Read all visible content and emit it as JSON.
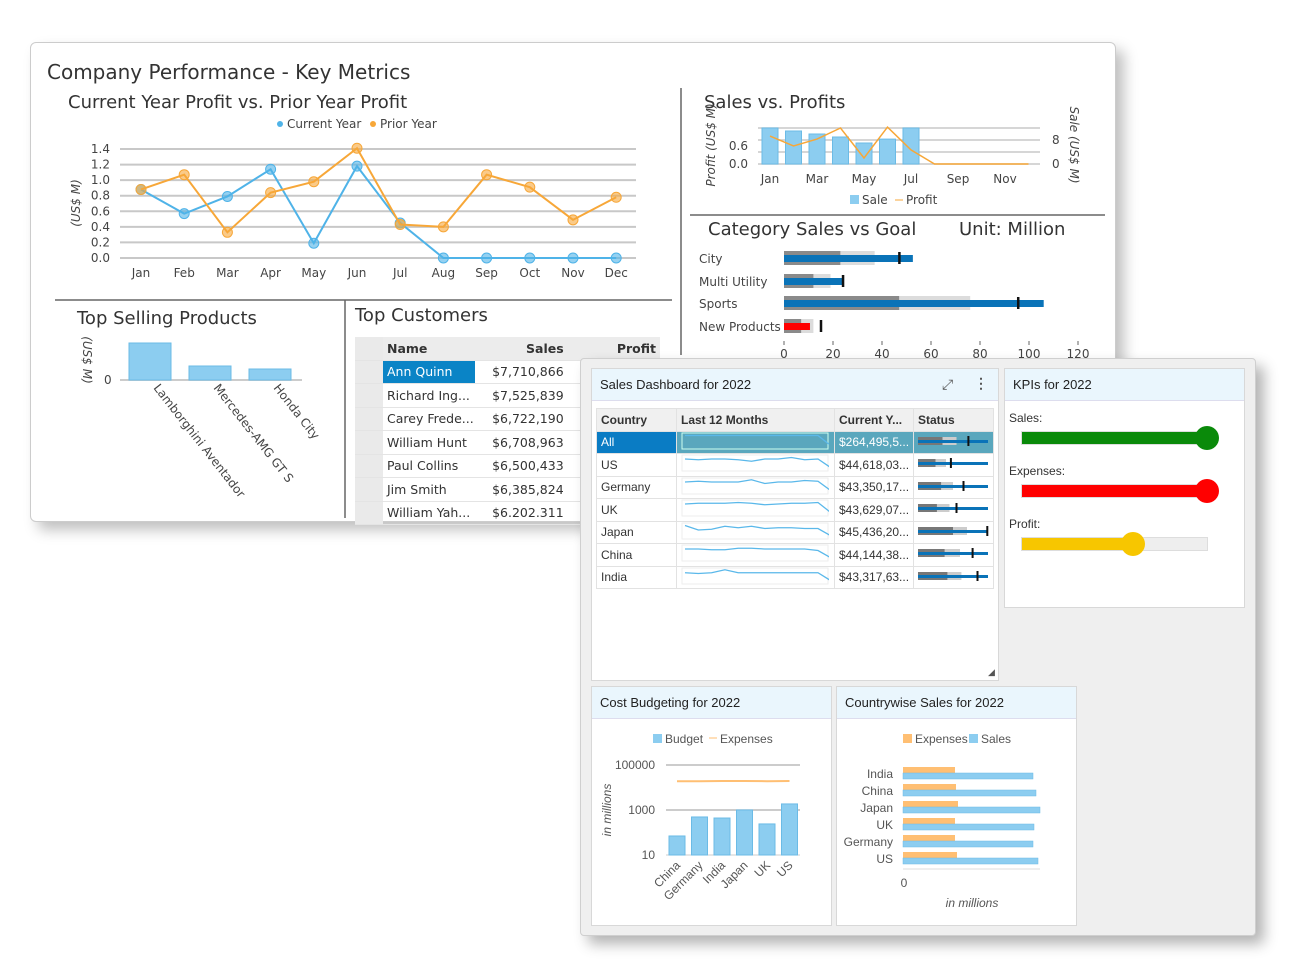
{
  "dashboard": {
    "title": "Company Performance - Key Metrics"
  },
  "profit_chart": {
    "title": "Current Year Profit vs. Prior Year Profit",
    "ylabel": "(US$ M)",
    "categories": [
      "Jan",
      "Feb",
      "Mar",
      "Apr",
      "May",
      "Jun",
      "Jul",
      "Aug",
      "Sep",
      "Oct",
      "Nov",
      "Dec"
    ],
    "yticks": [
      "0.0",
      "0.2",
      "0.4",
      "0.6",
      "0.8",
      "1.0",
      "1.2",
      "1.4"
    ],
    "series": [
      {
        "name": "Current Year",
        "color": "#4fb3e8",
        "values": [
          0.88,
          0.57,
          0.79,
          1.14,
          0.19,
          1.18,
          0.45,
          0,
          0,
          0,
          0,
          0
        ]
      },
      {
        "name": "Prior Year",
        "color": "#f7a738",
        "values": [
          0.88,
          1.07,
          0.33,
          0.84,
          0.98,
          1.41,
          0.43,
          0.4,
          1.07,
          0.91,
          0.49,
          0.78
        ]
      }
    ]
  },
  "sales_profits": {
    "title": "Sales vs. Profits",
    "ylabel_left": "Profit (US$ M)",
    "ylabel_right": "Sale (US$ M)",
    "xticks": [
      "Jan",
      "Mar",
      "May",
      "Jul",
      "Sep",
      "Nov"
    ],
    "left_ticks": [
      "0.0",
      "0.6"
    ],
    "right_ticks": [
      "0",
      "8"
    ],
    "sale": {
      "name": "Sale",
      "values": [
        12,
        11,
        10,
        9,
        7,
        8.3,
        12
      ]
    },
    "profit": {
      "name": "Profit",
      "values": [
        0.93,
        0.6,
        0.83,
        1.2,
        0.2,
        1.23,
        0.47,
        0,
        0,
        0,
        0,
        0
      ]
    }
  },
  "bullet": {
    "title": "Category Sales vs Goal",
    "unit": "Unit: Million",
    "xticks": [
      "0",
      "20",
      "40",
      "60",
      "80",
      "100",
      "120"
    ],
    "rows": [
      {
        "label": "City",
        "value": 52.6,
        "target": 47,
        "ranges": [
          23,
          37
        ],
        "color": "#0a73b8"
      },
      {
        "label": "Multi Utility",
        "value": 24,
        "target": 24,
        "ranges": [
          12,
          19
        ],
        "color": "#0a73b8"
      },
      {
        "label": "Sports",
        "value": 106,
        "target": 95.5,
        "ranges": [
          47,
          76
        ],
        "color": "#0a73b8"
      },
      {
        "label": "New Products",
        "value": 10.6,
        "target": 15,
        "ranges": [
          7,
          12
        ],
        "color": "#ff0000"
      }
    ]
  },
  "top_products": {
    "title": "Top Selling Products",
    "ylabel": "(US$ M)",
    "ytick": "0",
    "categories": [
      "Lamborghini Aventador",
      "Mercedes-AMG GT S",
      "Honda City"
    ],
    "values": [
      3.7,
      1.4,
      1.1
    ]
  },
  "top_customers": {
    "title": "Top Customers",
    "columns": [
      "Name",
      "Sales",
      "Profit"
    ],
    "rows": [
      [
        "Ann Quinn",
        "$7,710,866"
      ],
      [
        "Richard Ing...",
        "$7,525,839"
      ],
      [
        "Carey Frede...",
        "$6,722,190"
      ],
      [
        "William Hunt",
        "$6,708,963"
      ],
      [
        "Paul Collins",
        "$6,500,433"
      ],
      [
        "Jim Smith",
        "$6,385,824"
      ],
      [
        "William Yah...",
        "$6.202.311"
      ]
    ]
  },
  "sales_dashboard": {
    "title": "Sales Dashboard for 2022",
    "columns": [
      "Country",
      "Last 12 Months",
      "Current Y...",
      "Status"
    ],
    "rows": [
      {
        "country": "All",
        "current": "$264,495,5...",
        "spark": [
          9,
          9,
          9,
          9,
          9,
          9,
          9,
          9,
          9,
          9,
          9,
          2
        ],
        "status": [
          0.35,
          0.55,
          0.72
        ]
      },
      {
        "country": "US",
        "current": "$44,618,03...",
        "spark": [
          8,
          7.5,
          8,
          8,
          7.5,
          6.5,
          8,
          8,
          9,
          7.5,
          8,
          2
        ],
        "status": [
          0.25,
          0.4,
          0.47
        ]
      },
      {
        "country": "Germany",
        "current": "$43,350,17...",
        "spark": [
          8,
          8.5,
          8,
          8,
          8,
          9.5,
          7,
          8,
          8,
          9,
          8.5,
          2
        ],
        "status": [
          0.33,
          0.5,
          0.65
        ]
      },
      {
        "country": "UK",
        "current": "$43,629,07...",
        "spark": [
          8,
          8.5,
          8.5,
          8.5,
          9,
          8.5,
          7.5,
          8,
          8.5,
          8.5,
          9,
          2
        ],
        "status": [
          0.27,
          0.45,
          0.55
        ]
      },
      {
        "country": "Japan",
        "current": "$45,436,20...",
        "spark": [
          9,
          6,
          6.5,
          8.5,
          7.5,
          8.5,
          7,
          7.5,
          7.5,
          7,
          7,
          2
        ],
        "status": [
          0.5,
          0.7,
          0.99
        ]
      },
      {
        "country": "China",
        "current": "$44,144,38...",
        "spark": [
          8,
          8,
          7.5,
          7.5,
          8.5,
          8.5,
          8,
          8,
          8,
          8,
          7,
          2
        ],
        "status": [
          0.38,
          0.6,
          0.78
        ]
      },
      {
        "country": "India",
        "current": "$43,317,63...",
        "spark": [
          7.5,
          7,
          7.5,
          9.5,
          7.5,
          7.5,
          7.5,
          7.5,
          7.5,
          7.5,
          7.5,
          2
        ],
        "status": [
          0.42,
          0.62,
          0.85
        ]
      }
    ]
  },
  "kpis": {
    "title": "KPIs for 2022",
    "items": [
      {
        "label": "Sales:",
        "value": 1.0,
        "color": "#0a8a0a"
      },
      {
        "label": "Expenses:",
        "value": 1.0,
        "color": "#ff0000"
      },
      {
        "label": "Profit:",
        "value": 0.6,
        "color": "#f7c600"
      }
    ]
  },
  "cost_budget": {
    "title": "Cost Budgeting for 2022",
    "ylabel": "in millions",
    "scale": "log",
    "yticks": [
      "10",
      "1000",
      "100000"
    ],
    "categories": [
      "China",
      "Germany",
      "India",
      "Japan",
      "UK",
      "US"
    ],
    "budget": {
      "name": "Budget",
      "values": [
        70,
        490,
        440,
        1000,
        240,
        1860
      ]
    },
    "expenses": {
      "name": "Expenses",
      "values": [
        19000,
        19000,
        19500,
        19500,
        19000,
        19500
      ]
    }
  },
  "countrywise": {
    "title": "Countrywise Sales for 2022",
    "xlabel": "in millions",
    "xtick": "0",
    "categories": [
      "India",
      "China",
      "Japan",
      "UK",
      "Germany",
      "US"
    ],
    "expenses": {
      "name": "Expenses",
      "values": [
        52,
        53,
        55,
        52,
        52,
        54
      ]
    },
    "sales": {
      "name": "Sales",
      "values": [
        130,
        133,
        137,
        131,
        130,
        135
      ]
    }
  },
  "colors": {
    "blue": "#8ccdf0",
    "orange": "#ffbf73",
    "accent": "#0a84c6"
  }
}
